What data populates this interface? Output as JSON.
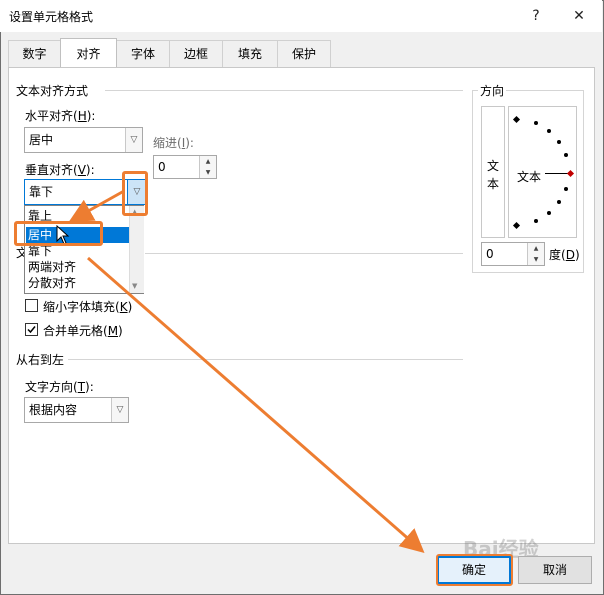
{
  "window": {
    "title": "设置单元格格式",
    "help_glyph": "?",
    "close_glyph": "✕"
  },
  "tabs": [
    "数字",
    "对齐",
    "字体",
    "边框",
    "填充",
    "保护"
  ],
  "text_alignment": {
    "group_title": "文本对齐方式",
    "horizontal_label": "水平对齐(",
    "horizontal_key": "H",
    "horizontal_value": "居中",
    "indent_label": "缩进(",
    "indent_key": "I",
    "indent_value": "0",
    "vertical_label": "垂直对齐(",
    "vertical_key": "V",
    "vertical_value": "靠下",
    "vertical_options": [
      "靠上",
      "居中",
      "靠下",
      "两端对齐",
      "分散对齐"
    ],
    "vertical_highlighted": "居中"
  },
  "text_control": {
    "group_title_partial": "文",
    "shrink_label": "缩小字体填充(",
    "shrink_key": "K",
    "shrink_checked": false,
    "merge_label": "合并单元格(",
    "merge_key": "M",
    "merge_checked": true
  },
  "rtl": {
    "group_title": "从右到左",
    "direction_label": "文字方向(",
    "direction_key": "T",
    "direction_value": "根据内容"
  },
  "orientation": {
    "title": "方向",
    "vertical_text": [
      "文",
      "本"
    ],
    "dial_text": "文本",
    "degree_value": "0",
    "degree_label": "度(",
    "degree_key": "D"
  },
  "buttons": {
    "ok": "确定",
    "cancel": "取消"
  },
  "watermark": "Bai经验",
  "colors": {
    "accent": "#0078d7",
    "annotation": "#ed7d31"
  }
}
